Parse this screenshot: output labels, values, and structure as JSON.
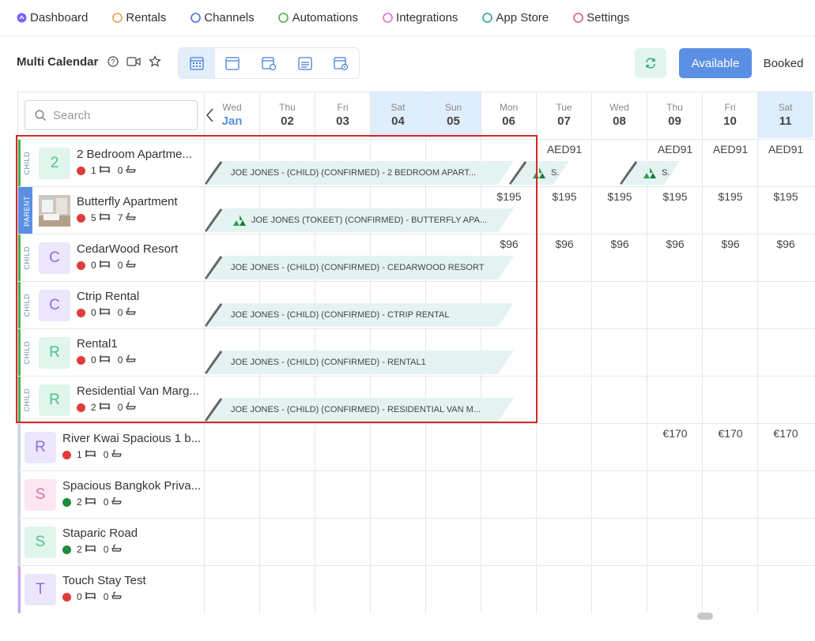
{
  "nav": {
    "items": [
      {
        "label": "Dashboard",
        "icon": "dashboard-icon",
        "color": "#7b61ff"
      },
      {
        "label": "Rentals",
        "icon": "rentals-icon",
        "color": "#f39c4a"
      },
      {
        "label": "Channels",
        "icon": "channels-icon",
        "color": "#4a6fd8"
      },
      {
        "label": "Automations",
        "icon": "automations-icon",
        "color": "#4cae4c"
      },
      {
        "label": "Integrations",
        "icon": "integrations-icon",
        "color": "#d66fd8"
      },
      {
        "label": "App Store",
        "icon": "app-store-icon",
        "color": "#2aa198"
      },
      {
        "label": "Settings",
        "icon": "settings-icon",
        "color": "#e05a8a"
      }
    ]
  },
  "header": {
    "title": "Multi Calendar",
    "available_label": "Available",
    "booked_label": "Booked"
  },
  "search": {
    "placeholder": "Search"
  },
  "dates": [
    {
      "dow": "Wed",
      "num": "Jan",
      "weekend": false,
      "month": true
    },
    {
      "dow": "Thu",
      "num": "02",
      "weekend": false
    },
    {
      "dow": "Fri",
      "num": "03",
      "weekend": false
    },
    {
      "dow": "Sat",
      "num": "04",
      "weekend": true
    },
    {
      "dow": "Sun",
      "num": "05",
      "weekend": true
    },
    {
      "dow": "Mon",
      "num": "06",
      "weekend": false
    },
    {
      "dow": "Tue",
      "num": "07",
      "weekend": false
    },
    {
      "dow": "Wed",
      "num": "08",
      "weekend": false
    },
    {
      "dow": "Thu",
      "num": "09",
      "weekend": false
    },
    {
      "dow": "Fri",
      "num": "10",
      "weekend": false
    },
    {
      "dow": "Sat",
      "num": "11",
      "weekend": true
    }
  ],
  "rentals": [
    {
      "tag": "CHILD",
      "initial": "2",
      "avatar_bg": "#e0f5ec",
      "avatar_fg": "#4cc38a",
      "name": "2 Bedroom Apartme...",
      "status": "#e03c3c",
      "beds": "1",
      "baths": "0",
      "prices": [
        "",
        "",
        "",
        "",
        "",
        "",
        "AED91",
        "",
        "AED91",
        "AED91",
        "AED91"
      ]
    },
    {
      "tag": "PARENT",
      "initial": "",
      "photo": true,
      "name": "Butterfly Apartment",
      "status": "#e03c3c",
      "beds": "5",
      "baths": "7",
      "prices": [
        "",
        "",
        "",
        "",
        "",
        "$195",
        "$195",
        "$195",
        "$195",
        "$195",
        "$195"
      ]
    },
    {
      "tag": "CHILD",
      "initial": "C",
      "avatar_bg": "#ebe6fb",
      "avatar_fg": "#8a72e0",
      "name": "CedarWood Resort",
      "status": "#e03c3c",
      "beds": "0",
      "baths": "0",
      "prices": [
        "",
        "",
        "",
        "",
        "",
        "$96",
        "$96",
        "$96",
        "$96",
        "$96",
        "$96"
      ]
    },
    {
      "tag": "CHILD",
      "initial": "C",
      "avatar_bg": "#ebe6fb",
      "avatar_fg": "#8a72e0",
      "name": "Ctrip Rental",
      "status": "#e03c3c",
      "beds": "0",
      "baths": "0",
      "prices": [
        "",
        "",
        "",
        "",
        "",
        "",
        "",
        "",
        "",
        "",
        ""
      ]
    },
    {
      "tag": "CHILD",
      "initial": "R",
      "avatar_bg": "#e0f5ec",
      "avatar_fg": "#4cc38a",
      "name": "Rental1",
      "status": "#e03c3c",
      "beds": "0",
      "baths": "0",
      "prices": [
        "",
        "",
        "",
        "",
        "",
        "",
        "",
        "",
        "",
        "",
        ""
      ]
    },
    {
      "tag": "CHILD",
      "initial": "R",
      "avatar_bg": "#e0f5ec",
      "avatar_fg": "#4cc38a",
      "name": "Residential Van Marg...",
      "status": "#e03c3c",
      "beds": "2",
      "baths": "0",
      "prices": [
        "",
        "",
        "",
        "",
        "",
        "",
        "",
        "",
        "",
        "",
        ""
      ]
    },
    {
      "tag": "",
      "initial": "R",
      "avatar_bg": "#ebe6fb",
      "avatar_fg": "#8a72e0",
      "name": "River Kwai Spacious 1 b...",
      "status": "#e03c3c",
      "beds": "1",
      "baths": "0",
      "prices": [
        "",
        "",
        "",
        "",
        "",
        "",
        "",
        "",
        "€170",
        "€170",
        "€170"
      ]
    },
    {
      "tag": "",
      "initial": "S",
      "avatar_bg": "#fbe6f1",
      "avatar_fg": "#e06fae",
      "name": "Spacious Bangkok Priva...",
      "status": "#1f8a3b",
      "beds": "2",
      "baths": "0",
      "prices": [
        "",
        "",
        "",
        "",
        "",
        "",
        "",
        "",
        "",
        "",
        ""
      ]
    },
    {
      "tag": "",
      "initial": "S",
      "avatar_bg": "#e0f5ec",
      "avatar_fg": "#4cc38a",
      "name": "Staparic Road",
      "status": "#1f8a3b",
      "beds": "2",
      "baths": "0",
      "prices": [
        "",
        "",
        "",
        "",
        "",
        "",
        "",
        "",
        "",
        "",
        ""
      ]
    },
    {
      "tag": "",
      "initial": "T",
      "avatar_bg": "#ebe6fb",
      "avatar_fg": "#8a72e0",
      "name": "Touch Stay Test",
      "status": "#e03c3c",
      "beds": "0",
      "baths": "0",
      "prices": [
        "",
        "",
        "",
        "",
        "",
        "",
        "",
        "",
        "",
        "",
        ""
      ]
    }
  ],
  "bookings": [
    {
      "row": 0,
      "label": "JOE JONES - (CHILD) (CONFIRMED) - 2 BEDROOM APART...",
      "logo": false,
      "start": 0,
      "span": 5.6
    },
    {
      "row": 0,
      "label": "S.",
      "logo": true,
      "start": 5.5,
      "span": 1.1
    },
    {
      "row": 0,
      "label": "S.",
      "logo": true,
      "start": 7.5,
      "span": 1.1
    },
    {
      "row": 1,
      "label": "JOE JONES (TOKEET) (CONFIRMED) - BUTTERFLY APA...",
      "logo": true,
      "start": 0,
      "span": 5.6
    },
    {
      "row": 2,
      "label": "JOE JONES - (CHILD) (CONFIRMED) - CEDARWOOD RESORT",
      "logo": false,
      "start": 0,
      "span": 5.6
    },
    {
      "row": 3,
      "label": "JOE JONES - (CHILD) (CONFIRMED) - CTRIP RENTAL",
      "logo": false,
      "start": 0,
      "span": 5.6
    },
    {
      "row": 4,
      "label": "JOE JONES - (CHILD) (CONFIRMED) - RENTAL1",
      "logo": false,
      "start": 0,
      "span": 5.6
    },
    {
      "row": 5,
      "label": "JOE JONES - (CHILD) (CONFIRMED) - RESIDENTIAL VAN M...",
      "logo": false,
      "start": 0,
      "span": 5.6
    }
  ]
}
